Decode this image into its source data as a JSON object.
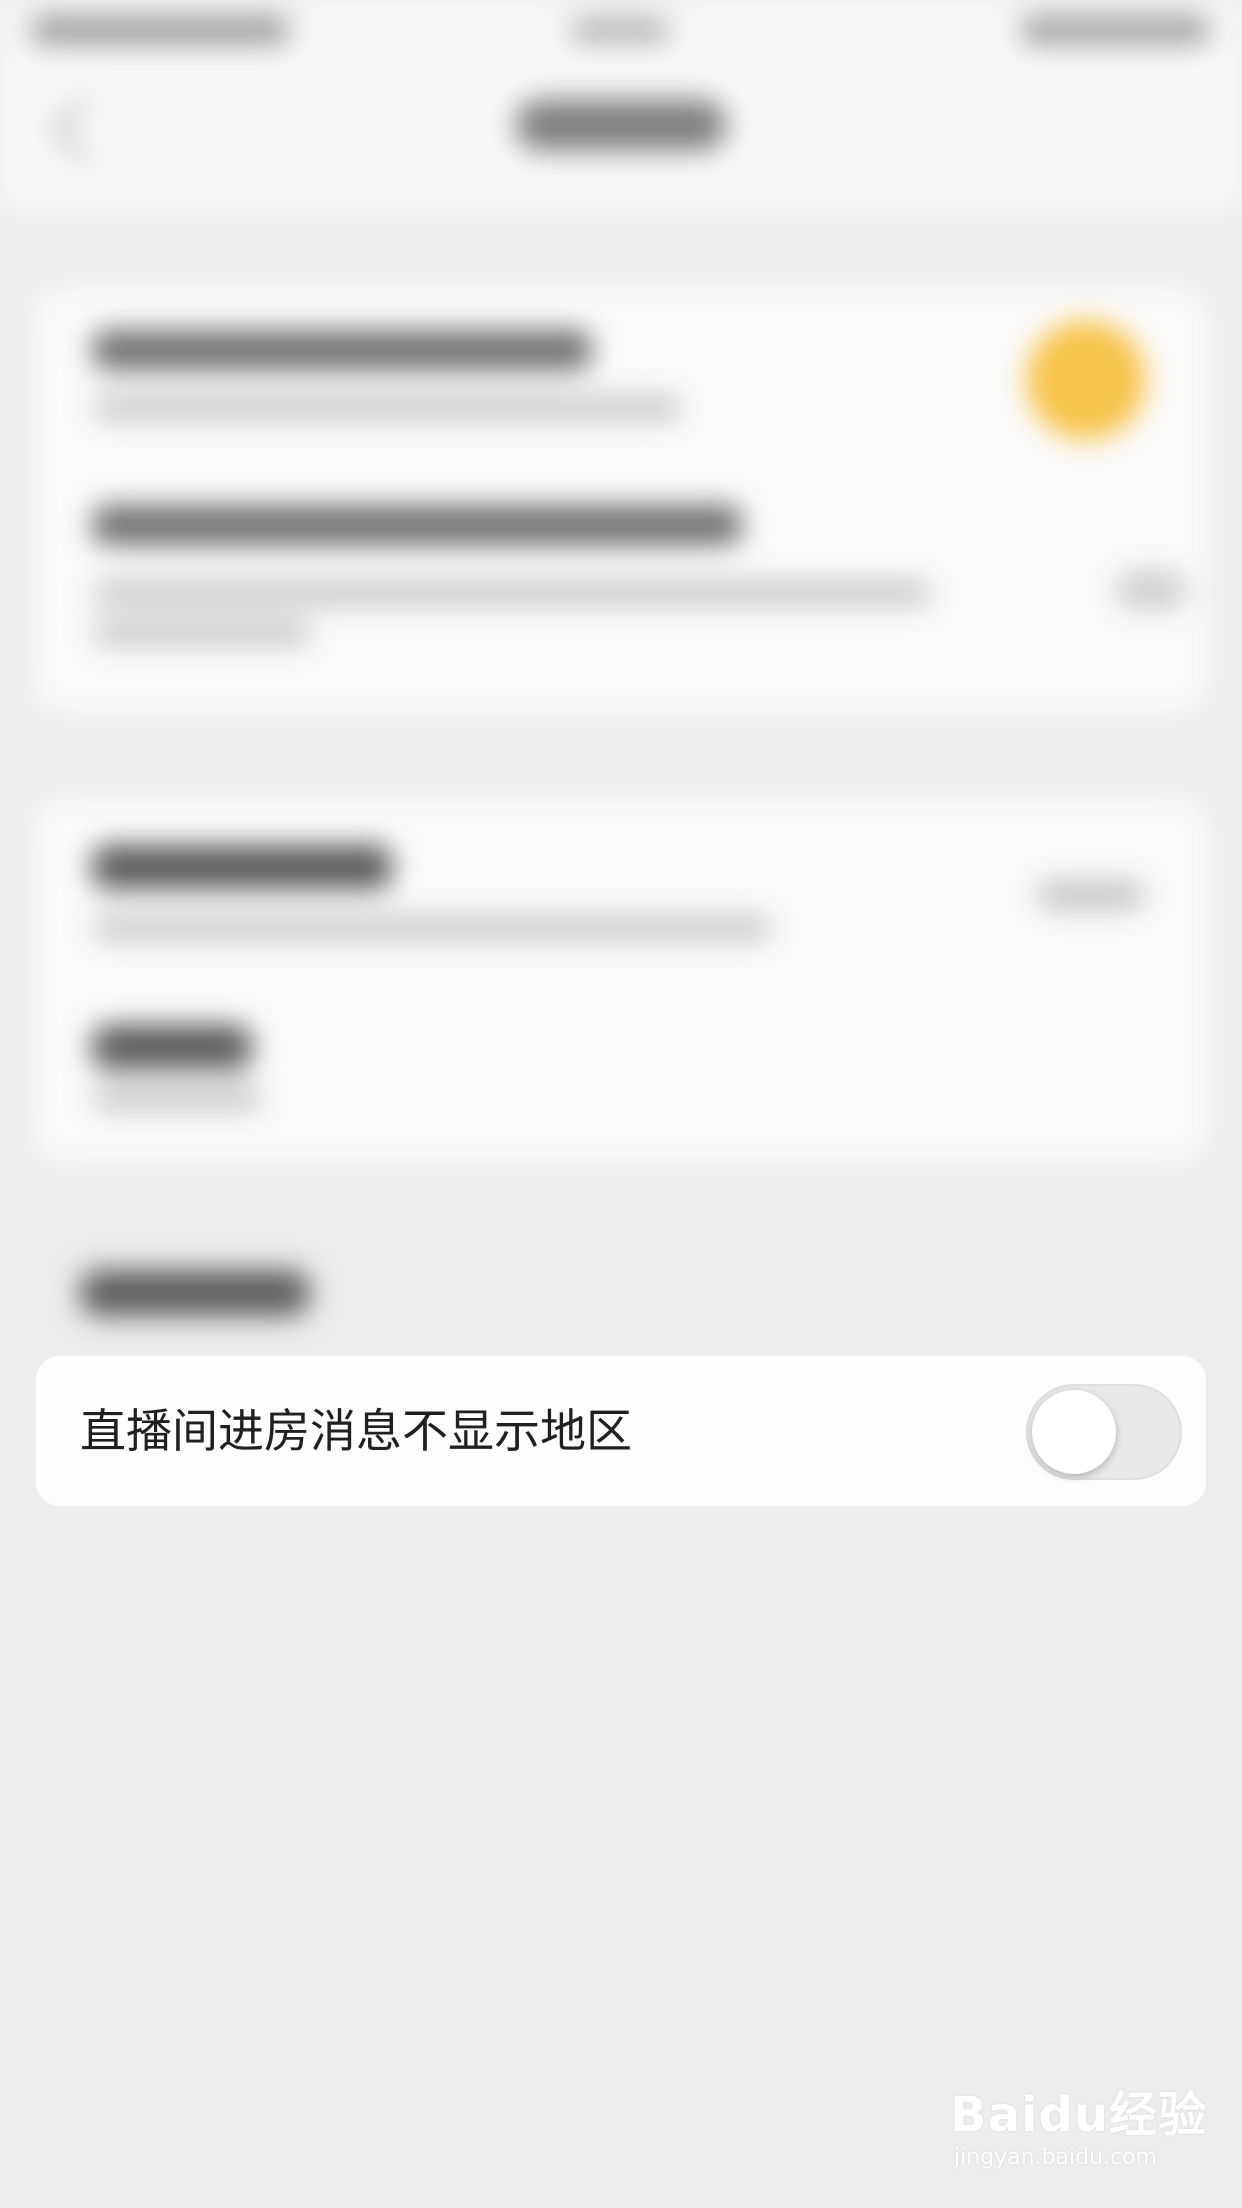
{
  "setting": {
    "label": "直播间进房消息不显示地区",
    "toggle_on": false
  },
  "watermark": {
    "logo": "Baidu经验",
    "url": "jingyan.baidu.com"
  },
  "colors": {
    "background": "#ededed",
    "card": "#fdfdfd",
    "accent_blurred": "#f7c34a",
    "toggle_off_track": "#e8e8e8",
    "text": "#202020"
  }
}
